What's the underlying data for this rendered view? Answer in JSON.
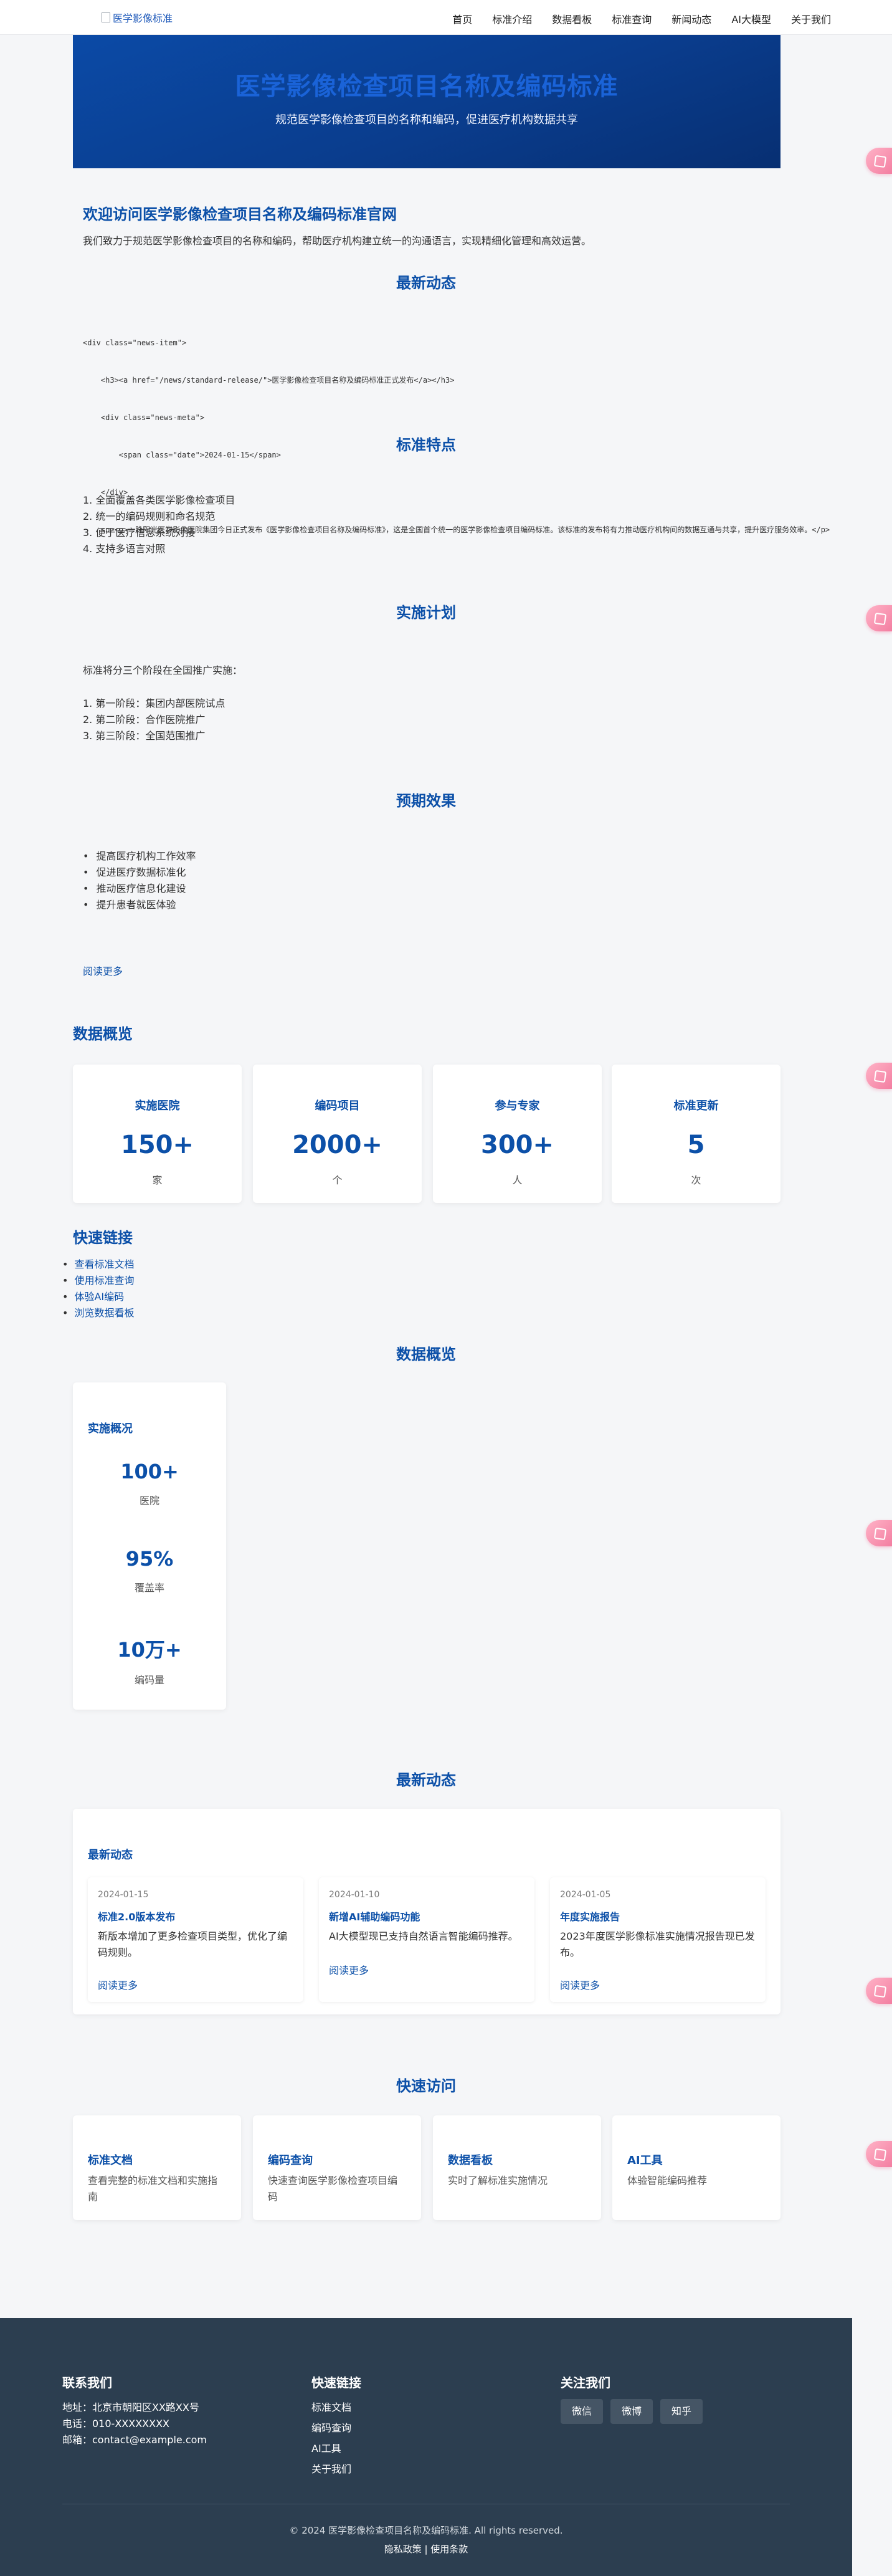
{
  "nav": {
    "logo_alt": "医学影像标准",
    "items": [
      "首页",
      "标准介绍",
      "数据看板",
      "标准查询",
      "新闻动态",
      "AI大模型",
      "关于我们"
    ]
  },
  "hero": {
    "title": "医学影像检查项目名称及编码标准",
    "subtitle": "规范医学影像检查项目的名称和编码，促进医疗机构数据共享"
  },
  "welcome": {
    "title": "欢迎访问医学影像检查项目名称及编码标准官网",
    "text": "我们致力于规范医学影像检查项目的名称和编码，帮助医疗机构建立统一的沟通语言，实现精细化管理和高效运营。"
  },
  "latest_news_title": "最新动态",
  "code_lines": [
    "<div class=\"news-item\">",
    "    <h3><a href=\"/news/standard-release/\">医学影像检查项目名称及编码标准正式发布</a></h3>",
    "    <div class=\"news-meta\">",
    "        <span class=\"date\">2024-01-15</span>",
    "    </div>",
    "    <p><p>一脉阳光医学影像医院集团今日正式发布《医学影像检查项目名称及编码标准》，这是全国首个统一的医学影像检查项目编码标准。该标准的发布将有力推动医疗机构间的数据互通与共享，提升医疗服务效率。</p>"
  ],
  "features": {
    "title": "标准特点",
    "items": [
      "1. 全面覆盖各类医学影像检查项目",
      "2. 统一的编码规则和命名规范",
      "3. 便于医疗信息系统对接",
      "4. 支持多语言对照"
    ]
  },
  "plan": {
    "title": "实施计划",
    "intro": "标准将分三个阶段在全国推广实施：",
    "items": [
      "1. 第一阶段：集团内部医院试点",
      "2. 第二阶段：合作医院推广",
      "3. 第三阶段：全国范围推广"
    ]
  },
  "effects": {
    "title": "预期效果",
    "items": [
      "提高医疗机构工作效率",
      "促进医疗数据标准化",
      "推动医疗信息化建设",
      "提升患者就医体验"
    ]
  },
  "read_more": "阅读更多",
  "data_overview": {
    "title": "数据概览",
    "cards": [
      {
        "title": "实施医院",
        "value": "150+",
        "unit": "家"
      },
      {
        "title": "编码项目",
        "value": "2000+",
        "unit": "个"
      },
      {
        "title": "参与专家",
        "value": "300+",
        "unit": "人"
      },
      {
        "title": "标准更新",
        "value": "5",
        "unit": "次"
      }
    ]
  },
  "quick_links": {
    "title": "快速链接",
    "items": [
      "查看标准文档",
      "使用标准查询",
      "体验AI编码",
      "浏览数据看板"
    ]
  },
  "overview2": {
    "title": "数据概览",
    "card_title": "实施概况",
    "items": [
      {
        "value": "100+",
        "label": "医院"
      },
      {
        "value": "95%",
        "label": "覆盖率"
      },
      {
        "value": "10万+",
        "label": "编码量"
      }
    ]
  },
  "news2": {
    "title": "最新动态",
    "card_title": "最新动态",
    "items": [
      {
        "date": "2024-01-15",
        "title": "标准2.0版本发布",
        "text": "新版本增加了更多检查项目类型，优化了编码规则。",
        "more": "阅读更多"
      },
      {
        "date": "2024-01-10",
        "title": "新增AI辅助编码功能",
        "text": "AI大模型现已支持自然语言智能编码推荐。",
        "more": "阅读更多"
      },
      {
        "date": "2024-01-05",
        "title": "年度实施报告",
        "text": "2023年度医学影像标准实施情况报告现已发布。",
        "more": "阅读更多"
      }
    ]
  },
  "quick_access": {
    "title": "快速访问",
    "items": [
      {
        "title": "标准文档",
        "text": "查看完整的标准文档和实施指南"
      },
      {
        "title": "编码查询",
        "text": "快速查询医学影像检查项目编码"
      },
      {
        "title": "数据看板",
        "text": "实时了解标准实施情况"
      },
      {
        "title": "AI工具",
        "text": "体验智能编码推荐"
      }
    ]
  },
  "footer": {
    "contact_title": "联系我们",
    "address": "地址：北京市朝阳区XX路XX号",
    "phone": "电话：010-XXXXXXXX",
    "email": "邮箱：contact@example.com",
    "links_title": "快速链接",
    "links": [
      "标准文档",
      "编码查询",
      "AI工具",
      "关于我们"
    ],
    "follow_title": "关注我们",
    "social": [
      "微信",
      "微博",
      "知乎"
    ],
    "copyright": "© 2024 医学影像检查项目名称及编码标准. All rights reserved.",
    "legal": "隐私政策 | 使用条款"
  }
}
